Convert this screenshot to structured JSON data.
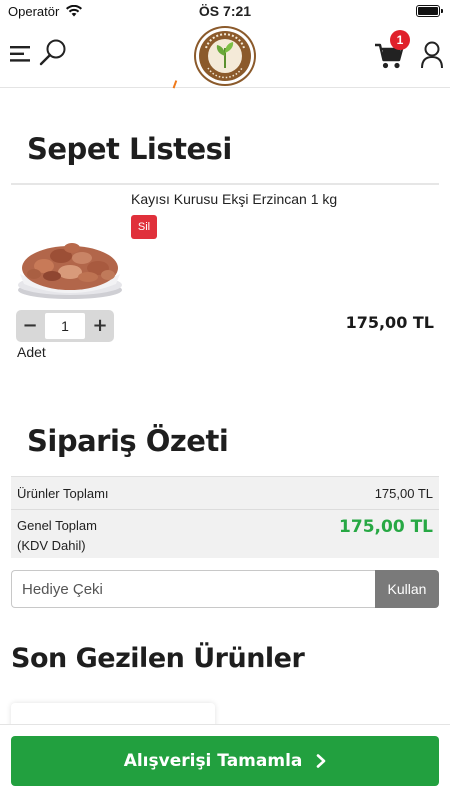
{
  "status_bar": {
    "carrier": "Operatör",
    "time": "ÖS 7:21"
  },
  "header": {
    "cart_count": "1",
    "logo_alt": "yörepazarım.com"
  },
  "cart": {
    "title": "Sepet Listesi",
    "item": {
      "name": "Kayısı Kurusu Ekşi Erzincan 1 kg",
      "delete_label": "Sil",
      "quantity": "1",
      "quantity_label": "Adet",
      "price": "175,00 TL"
    }
  },
  "summary": {
    "title": "Sipariş Özeti",
    "products_total_label": "Ürünler Toplamı",
    "products_total_value": "175,00 TL",
    "grand_total_label_line1": "Genel Toplam",
    "grand_total_label_line2": "(KDV Dahil)",
    "grand_total_value": "175,00 TL"
  },
  "coupon": {
    "placeholder": "Hediye Çeki",
    "button_label": "Kullan"
  },
  "recent": {
    "title": "Son Gezilen Ürünler"
  },
  "checkout": {
    "button_label": "Alışverişi Tamamla"
  },
  "colors": {
    "accent_green": "#22a03f",
    "badge_red": "#e0202a",
    "logo_brown": "#8b5a2b"
  }
}
